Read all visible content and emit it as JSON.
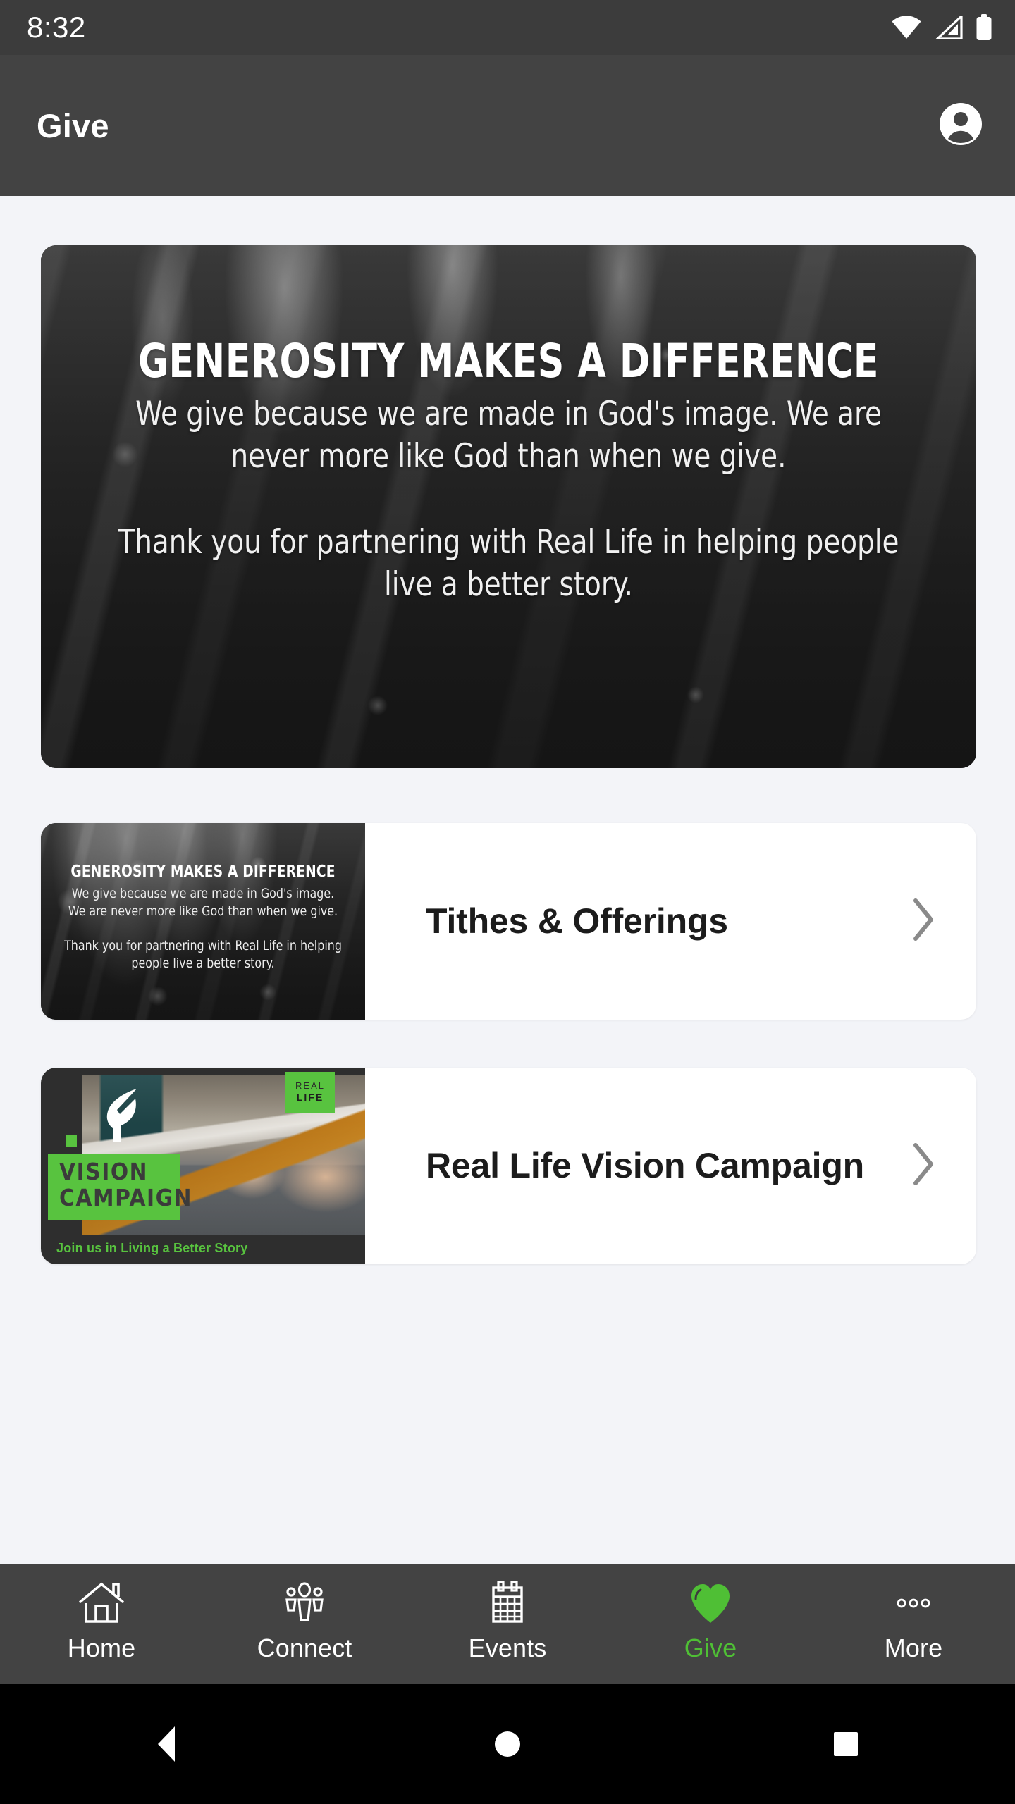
{
  "status_bar": {
    "clock": "8:32",
    "icons": [
      "wifi-icon",
      "cellular-signal-icon",
      "battery-icon"
    ]
  },
  "app_bar": {
    "title": "Give",
    "account_icon": "account-circle-icon"
  },
  "hero": {
    "headline": "GENEROSITY MAKES A DIFFERENCE",
    "paragraph1": "We give because we are made in God's image. We are never more like God than when we give.",
    "paragraph2": "Thank you for partnering with Real Life in helping people live a better story."
  },
  "give_list": [
    {
      "title": "Tithes & Offerings",
      "chevron": "chevron-right-icon",
      "thumbnail": {
        "type": "worship-photo",
        "headline": "GENEROSITY MAKES A DIFFERENCE",
        "paragraph1": "We give because we are made in God's image. We are never more like God than when we give.",
        "paragraph2": "Thank you for partnering with Real Life in helping people live a better story."
      }
    },
    {
      "title": "Real Life Vision Campaign",
      "chevron": "chevron-right-icon",
      "thumbnail": {
        "type": "vision-campaign-photo",
        "logo": "real-life-leaf-logo",
        "badge_line1": "REAL",
        "badge_line2": "LIFE",
        "block_line1": "VISION",
        "block_line2": "CAMPAIGN",
        "tagline": "Join us in Living a Better Story"
      }
    }
  ],
  "bottom_nav": {
    "items": [
      {
        "label": "Home",
        "icon": "home-icon",
        "active": false
      },
      {
        "label": "Connect",
        "icon": "people-icon",
        "active": false
      },
      {
        "label": "Events",
        "icon": "calendar-icon",
        "active": false
      },
      {
        "label": "Give",
        "icon": "heart-icon",
        "active": true
      },
      {
        "label": "More",
        "icon": "more-dots-icon",
        "active": false
      }
    ],
    "active_color": "#4FBF35"
  },
  "android_nav": {
    "buttons": [
      "back-button",
      "home-button",
      "recents-button"
    ]
  },
  "colors": {
    "status_bar_bg": "#3C3C3C",
    "app_bar_bg": "#434343",
    "page_bg": "#F3F4F8",
    "card_bg": "#FFFFFF",
    "brand_green": "#58C33F",
    "accent_green": "#4FBF35",
    "title_text": "#1C1C1C"
  }
}
